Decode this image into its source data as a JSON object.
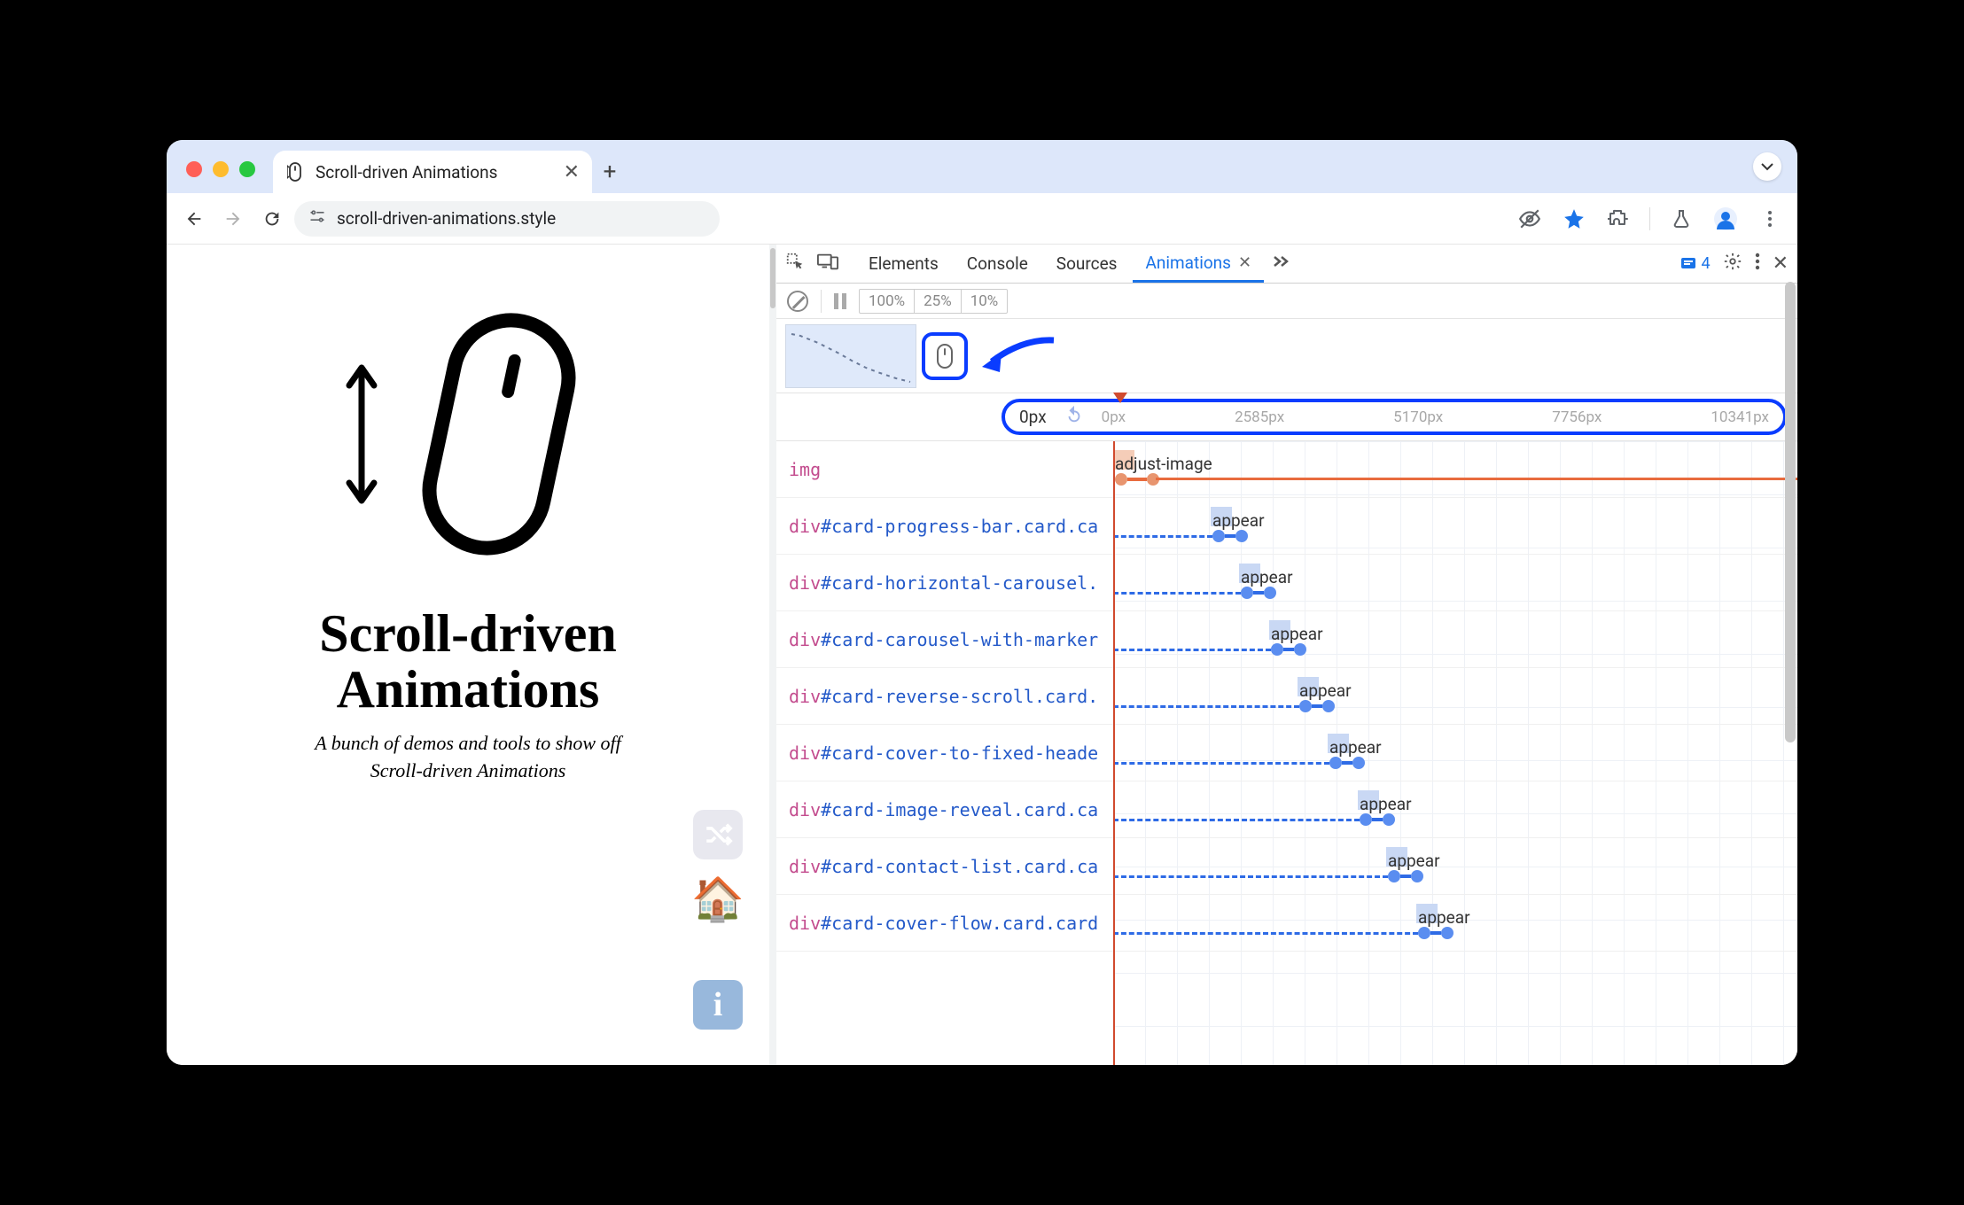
{
  "tab": {
    "title": "Scroll-driven Animations"
  },
  "toolbar": {
    "url": "scroll-driven-animations.style"
  },
  "page": {
    "title_line1": "Scroll-driven",
    "title_line2": "Animations",
    "subtitle_line1": "A bunch of demos and tools to show off",
    "subtitle_line2": "Scroll-driven Animations"
  },
  "devtools": {
    "tabs": [
      "Elements",
      "Console",
      "Sources",
      "Animations"
    ],
    "active_tab_index": 3,
    "issue_count": "4",
    "speed_options": [
      "100%",
      "25%",
      "10%"
    ],
    "ruler": {
      "current": "0px",
      "ticks": [
        "0px",
        "2585px",
        "5170px",
        "7756px",
        "10341px"
      ]
    },
    "rows": [
      {
        "selector_tag": "img",
        "selector_rest": "",
        "anim_name": "adjust-image",
        "offset": 2,
        "first": true
      },
      {
        "selector_tag": "div",
        "selector_rest": "#card-progress-bar.card.ca",
        "anim_name": "appear",
        "offset": 112
      },
      {
        "selector_tag": "div",
        "selector_rest": "#card-horizontal-carousel.",
        "anim_name": "appear",
        "offset": 144
      },
      {
        "selector_tag": "div",
        "selector_rest": "#card-carousel-with-marker",
        "anim_name": "appear",
        "offset": 178
      },
      {
        "selector_tag": "div",
        "selector_rest": "#card-reverse-scroll.card.",
        "anim_name": "appear",
        "offset": 210
      },
      {
        "selector_tag": "div",
        "selector_rest": "#card-cover-to-fixed-heade",
        "anim_name": "appear",
        "offset": 244
      },
      {
        "selector_tag": "div",
        "selector_rest": "#card-image-reveal.card.ca",
        "anim_name": "appear",
        "offset": 278
      },
      {
        "selector_tag": "div",
        "selector_rest": "#card-contact-list.card.ca",
        "anim_name": "appear",
        "offset": 310
      },
      {
        "selector_tag": "div",
        "selector_rest": "#card-cover-flow.card.card",
        "anim_name": "appear",
        "offset": 344
      }
    ]
  }
}
